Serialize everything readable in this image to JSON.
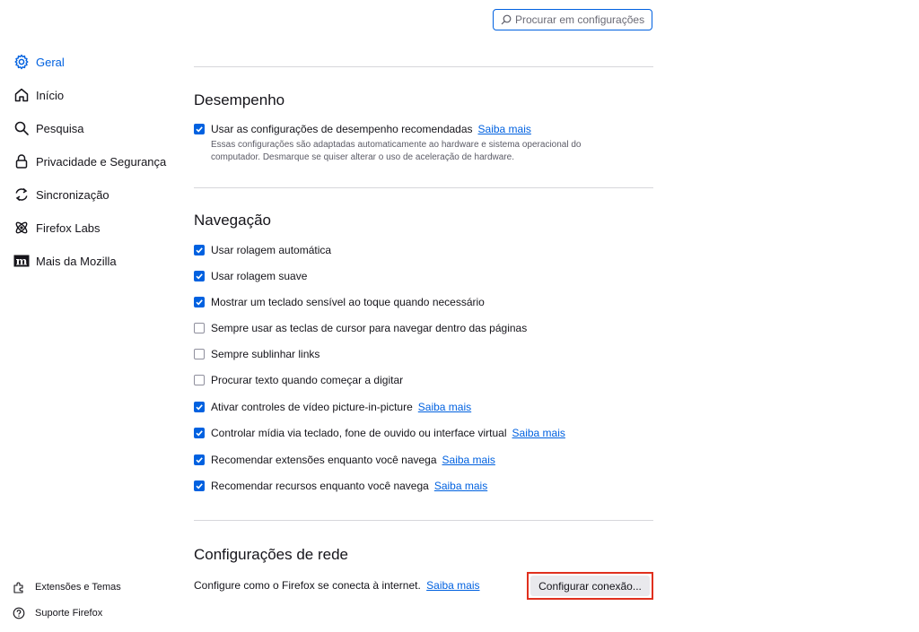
{
  "search": {
    "placeholder": "Procurar em configurações"
  },
  "sidebar": {
    "items": [
      {
        "label": "Geral",
        "icon": "gear-icon",
        "selected": true
      },
      {
        "label": "Início",
        "icon": "home-icon"
      },
      {
        "label": "Pesquisa",
        "icon": "search-icon"
      },
      {
        "label": "Privacidade e Segurança",
        "icon": "lock-icon"
      },
      {
        "label": "Sincronização",
        "icon": "sync-icon"
      },
      {
        "label": "Firefox Labs",
        "icon": "labs-icon"
      },
      {
        "label": "Mais da Mozilla",
        "icon": "mozilla-icon"
      }
    ],
    "footer": [
      {
        "label": "Extensões e Temas",
        "icon": "puzzle-icon"
      },
      {
        "label": "Suporte Firefox",
        "icon": "help-icon"
      }
    ]
  },
  "performance": {
    "title": "Desempenho",
    "recommended": {
      "label": "Usar as configurações de desempenho recomendadas",
      "checked": true,
      "link": "Saiba mais"
    },
    "description": "Essas configurações são adaptadas automaticamente ao hardware e sistema operacional do computador. Desmarque se quiser alterar o uso de aceleração de hardware."
  },
  "navigation": {
    "title": "Navegação",
    "options": [
      {
        "label": "Usar rolagem automática",
        "checked": true
      },
      {
        "label": "Usar rolagem suave",
        "checked": true
      },
      {
        "label": "Mostrar um teclado sensível ao toque quando necessário",
        "checked": true
      },
      {
        "label": "Sempre usar as teclas de cursor para navegar dentro das páginas",
        "checked": false
      },
      {
        "label": "Sempre sublinhar links",
        "checked": false
      },
      {
        "label": "Procurar texto quando começar a digitar",
        "checked": false
      },
      {
        "label": "Ativar controles de vídeo picture-in-picture",
        "checked": true,
        "link": "Saiba mais"
      },
      {
        "label": "Controlar mídia via teclado, fone de ouvido ou interface virtual",
        "checked": true,
        "link": "Saiba mais"
      },
      {
        "label": "Recomendar extensões enquanto você navega",
        "checked": true,
        "link": "Saiba mais"
      },
      {
        "label": "Recomendar recursos enquanto você navega",
        "checked": true,
        "link": "Saiba mais"
      }
    ]
  },
  "network": {
    "title": "Configurações de rede",
    "description": "Configure como o Firefox se conecta à internet.",
    "link": "Saiba mais",
    "button": "Configurar conexão..."
  },
  "colors": {
    "accent": "#0061e0",
    "highlight_border": "#e0301e"
  }
}
